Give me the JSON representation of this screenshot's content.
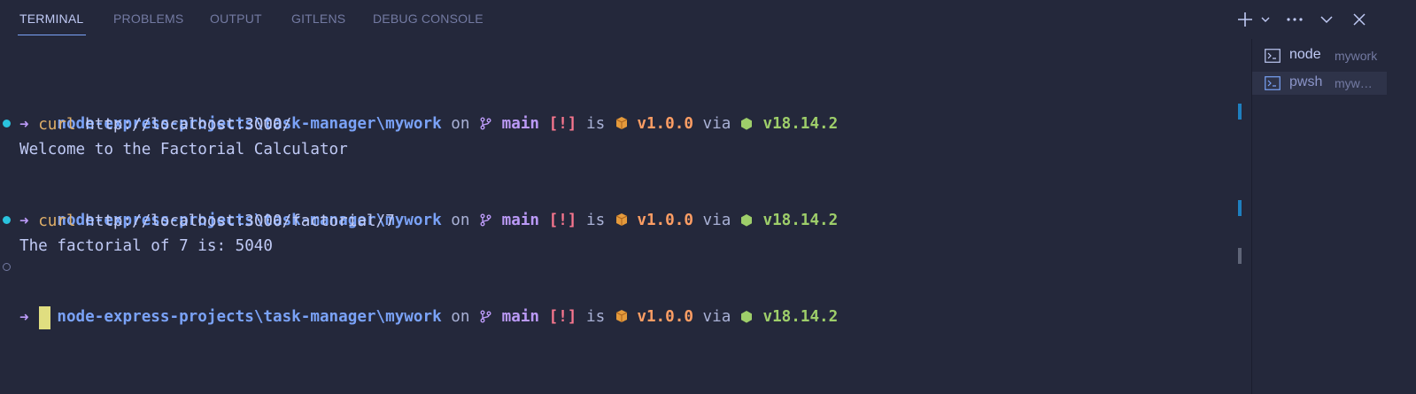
{
  "tabs": [
    {
      "label": "TERMINAL",
      "active": true
    },
    {
      "label": "PROBLEMS",
      "active": false
    },
    {
      "label": "OUTPUT",
      "active": false
    },
    {
      "label": "GITLENS",
      "active": false
    },
    {
      "label": "DEBUG CONSOLE",
      "active": false
    }
  ],
  "controls": [
    "new-terminal-icon",
    "chevron-down-icon",
    "more-icon",
    "collapse-icon",
    "close-icon"
  ],
  "prompt": {
    "path": "node-express-projects\\task-manager\\mywork",
    "on": "on",
    "branch_icon": "git-branch-icon",
    "branch": "main",
    "status": "[!]",
    "is": "is",
    "package_icon": "package-icon",
    "version": "v1.0.0",
    "via": "via",
    "node_icon": "nodejs-icon",
    "node_version": "v18.14.2"
  },
  "commands": [
    {
      "arrow": "➜",
      "cmd": "curl",
      "arg": " http://localhost:3000/",
      "output": "Welcome to the Factorial Calculator"
    },
    {
      "arrow": "➜",
      "cmd": "curl",
      "arg": " http://localhost:3000/factorial/7",
      "output": "The factorial of 7 is: 5040"
    },
    {
      "arrow": "➜"
    }
  ],
  "terminals": [
    {
      "name": "node",
      "desc": "mywork",
      "selected": false
    },
    {
      "name": "pwsh",
      "desc": "mywork",
      "selected": true
    }
  ],
  "colors": {
    "background": "#24283b",
    "path": "#7aa2f7",
    "branch": "#bb9af7",
    "status": "#f7768e",
    "version": "#ff9e64",
    "node_version": "#9ece6a",
    "command": "#e0af68",
    "cursor": "#e0de80"
  }
}
